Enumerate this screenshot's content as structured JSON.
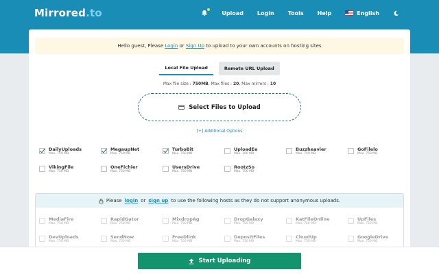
{
  "header": {
    "logo_main": "Mirrored",
    "logo_tld": ".to",
    "nav": {
      "upload": "Upload",
      "login": "Login",
      "tools": "Tools",
      "help": "Help",
      "language": "English"
    }
  },
  "notice": {
    "prefix": "Hello guest, Please ",
    "login": "Login",
    "or": " or ",
    "signup": "Sign Up",
    "suffix": " to upload to your own accounts on hosting sites"
  },
  "tabs": {
    "local": "Local File Upload",
    "remote": "Remote URL Upload"
  },
  "limits": {
    "size_label": "Max file size : ",
    "size_value": "750MB",
    "files_label": ", Max files : ",
    "files_value": "20",
    "mirrors_label": ", Max mirrors : ",
    "mirrors_value": "10"
  },
  "dropzone": {
    "label": "Select Files to Upload"
  },
  "additional_options": "[+] Additional Options",
  "hosts": [
    {
      "name": "DailyUploads",
      "size": "Max. 750 MB",
      "checked": true
    },
    {
      "name": "MegaupNet",
      "size": "Max. 750 MB",
      "checked": true
    },
    {
      "name": "TurboBit",
      "size": "Max. 750 MB",
      "checked": true
    },
    {
      "name": "UploadEe",
      "size": "Max. 100 MB",
      "checked": false
    },
    {
      "name": "Buzzheavier",
      "size": "Max. 750 MB",
      "checked": false
    },
    {
      "name": "GoFilelo",
      "size": "Max. 750 MB",
      "checked": false
    },
    {
      "name": "VikingFile",
      "size": "Max. 750 MB",
      "checked": false
    },
    {
      "name": "OneFichier",
      "size": "Max. 750 MB",
      "checked": false
    },
    {
      "name": "UsersDrive",
      "size": "Max. 750 MB",
      "checked": false
    },
    {
      "name": "RootzSo",
      "size": "Max. 750 MB",
      "checked": false
    }
  ],
  "login_required": {
    "prefix": "Please ",
    "login": "login",
    "or": " or ",
    "signup": "sign up",
    "suffix": " to use the following hosts as they do not support anonymous uploads."
  },
  "locked_hosts": [
    {
      "name": "MediaFire",
      "size": "Max. 750 MB"
    },
    {
      "name": "RapidGator",
      "size": "Max. 750 MB"
    },
    {
      "name": "MixdropAg",
      "size": "Max. 750 MB"
    },
    {
      "name": "DropGalaxy",
      "size": "Max. 750 MB"
    },
    {
      "name": "KatFileOnline",
      "size": "Max. 750 MB"
    },
    {
      "name": "UpFiles",
      "size": "Max. 750 MB"
    },
    {
      "name": "DevUploads",
      "size": "Max. 750 MB"
    },
    {
      "name": "SendNow",
      "size": "Max. 750 MB"
    },
    {
      "name": "FreeDlink",
      "size": "Max. 750 MB"
    },
    {
      "name": "DepositFiles",
      "size": "Max. 750 MB"
    },
    {
      "name": "CloudUp",
      "size": "Max. 750 MB"
    },
    {
      "name": "GoogleDrive",
      "size": "Max. 750 MB"
    }
  ],
  "start_button": "Start Uploading"
}
